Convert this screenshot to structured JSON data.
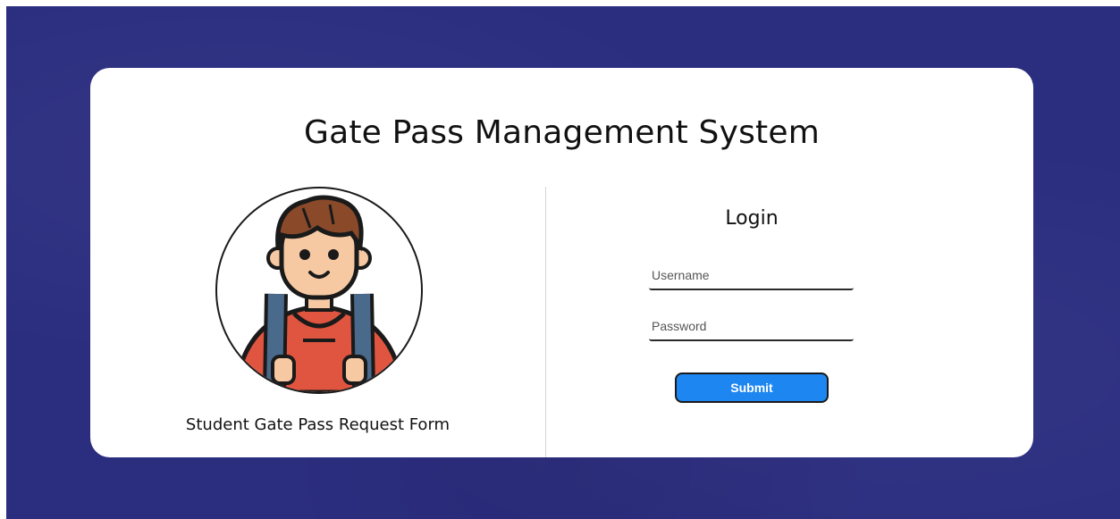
{
  "header": {
    "title": "Gate Pass Management System"
  },
  "left_panel": {
    "avatar_icon": "student-with-backpack-icon",
    "caption": "Student Gate Pass Request Form"
  },
  "login": {
    "title": "Login",
    "username_placeholder": "Username",
    "password_placeholder": "Password",
    "username_value": "",
    "password_value": "",
    "submit_label": "Submit"
  },
  "colors": {
    "background": "#2b2d7f",
    "card": "#ffffff",
    "submit_button": "#1e86f0",
    "hair": "#8a4a2a",
    "skin": "#f7c9a3",
    "shirt": "#e0553f",
    "backpack_straps": "#4a6a8c"
  }
}
